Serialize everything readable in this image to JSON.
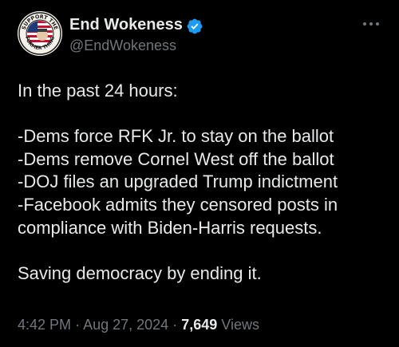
{
  "tweet": {
    "display_name": "End Wokeness",
    "handle": "@EndWokeness",
    "avatar": {
      "icon": "patriotic-seal-avatar-icon",
      "top_text": "SUPPORT THE",
      "bottom_text": "FORMER THING"
    },
    "verified_icon": "verified-badge-icon",
    "more_icon": "more-options-icon",
    "body_lines": [
      "In the past 24 hours:",
      "",
      "-Dems force RFK Jr. to stay on the ballot",
      "-Dems remove Cornel West off the ballot",
      "-DOJ files an upgraded Trump indictment",
      "-Facebook admits they censored posts in",
      "compliance with Biden-Harris requests.",
      "",
      "Saving democracy by ending it."
    ],
    "time": "4:42 PM",
    "separator": "·",
    "date": "Aug 27, 2024",
    "views_count": "7,649",
    "views_label": "Views"
  },
  "colors": {
    "background": "#000000",
    "text_primary": "#e7e9ea",
    "text_secondary": "#71767b",
    "verified_blue": "#1d9bf0"
  }
}
